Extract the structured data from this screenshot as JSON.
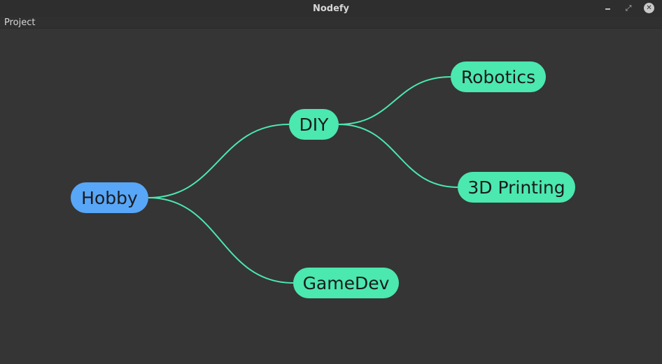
{
  "window": {
    "title": "Nodefy"
  },
  "menu": {
    "items": [
      "Project"
    ]
  },
  "colors": {
    "root_node": "#58a6f8",
    "child_node": "#4be8b0",
    "edge": "#4be8b0",
    "canvas_bg": "#353535",
    "node_text": "#1b1b1b"
  },
  "mindmap": {
    "root": "Hobby",
    "nodes": [
      {
        "id": "hobby",
        "label": "Hobby",
        "parent": null,
        "is_root": true
      },
      {
        "id": "diy",
        "label": "DIY",
        "parent": "hobby",
        "is_root": false
      },
      {
        "id": "gamedev",
        "label": "GameDev",
        "parent": "hobby",
        "is_root": false
      },
      {
        "id": "robotics",
        "label": "Robotics",
        "parent": "diy",
        "is_root": false
      },
      {
        "id": "printing",
        "label": "3D Printing",
        "parent": "diy",
        "is_root": false
      }
    ]
  }
}
